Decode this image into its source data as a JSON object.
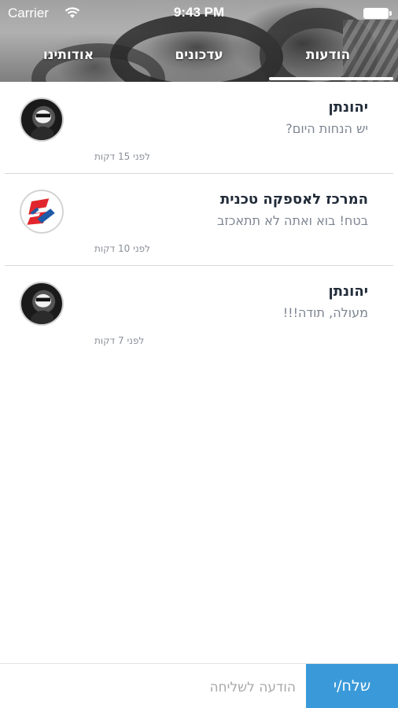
{
  "status_bar": {
    "carrier": "Carrier",
    "time": "9:43 PM",
    "icons": [
      "wifi-icon",
      "battery-icon"
    ]
  },
  "tabs": {
    "messages": "הודעות",
    "updates": "עדכונים",
    "about": "אודותינו",
    "active": "messages"
  },
  "messages": [
    {
      "sender": "יהונתן",
      "text": "יש הנחות היום?",
      "time": "לפני 15 דקות",
      "avatar": "person-avatar"
    },
    {
      "sender": "המרכז לאספקה טכנית",
      "text": "בטח! בוא ואתה לא תתאכזב",
      "time": "לפני 10 דקות",
      "avatar": "company-logo"
    },
    {
      "sender": "יהונתן",
      "text": "מעולה, תודה!!!",
      "time": "לפני 7 דקות",
      "avatar": "person-avatar"
    }
  ],
  "composer": {
    "placeholder": "הודעה לשליחה",
    "send_label": "שלח/י"
  },
  "colors": {
    "send_button": "#3a9ad9",
    "sender_name": "#222c3a",
    "message_text": "#7d8592",
    "logo_red": "#e0262c",
    "logo_blue": "#1f5aa6"
  }
}
